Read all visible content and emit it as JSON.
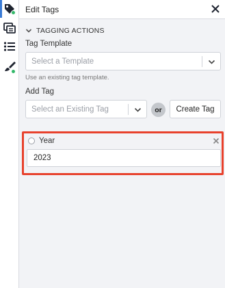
{
  "rail": {
    "icons": [
      {
        "name": "tag-icon",
        "active": true,
        "status_dot": true
      },
      {
        "name": "cards-icon",
        "active": false,
        "status_dot": false
      },
      {
        "name": "list-icon",
        "active": false,
        "status_dot": false
      },
      {
        "name": "brush-icon",
        "active": false,
        "status_dot": true
      }
    ]
  },
  "header": {
    "title": "Edit Tags",
    "close_icon": "close-icon"
  },
  "section": {
    "title": "TAGGING ACTIONS",
    "expanded": true
  },
  "tag_template": {
    "label": "Tag Template",
    "placeholder": "Select a Template",
    "hint": "Use an existing tag template."
  },
  "add_tag": {
    "label": "Add Tag",
    "placeholder": "Select an Existing Tag",
    "or_text": "or",
    "create_label": "Create Tag"
  },
  "tags": [
    {
      "name": "Year",
      "value": "2023"
    }
  ],
  "colors": {
    "accent": "#3a7bd5",
    "status_green": "#34b86a",
    "highlight_red": "#e8412c"
  }
}
